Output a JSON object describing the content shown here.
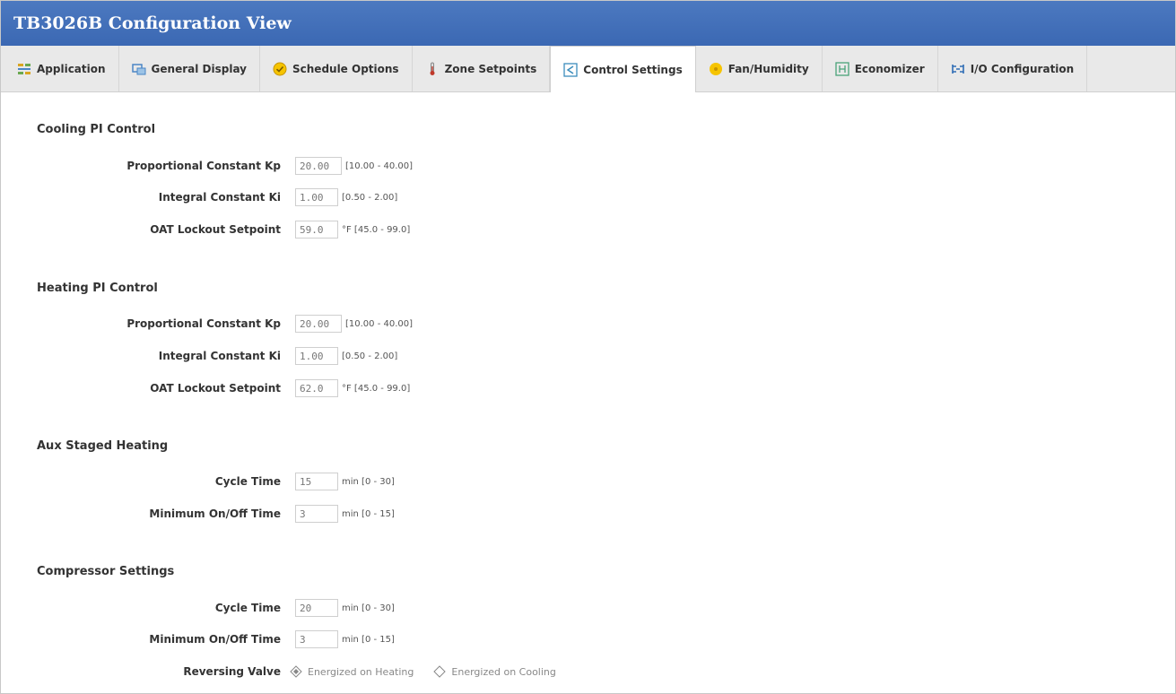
{
  "window": {
    "title": "TB3026B Configuration View"
  },
  "tabs": [
    {
      "label": "Application",
      "icon": "application-icon"
    },
    {
      "label": "General Display",
      "icon": "general-display-icon"
    },
    {
      "label": "Schedule Options",
      "icon": "schedule-icon"
    },
    {
      "label": "Zone Setpoints",
      "icon": "thermometer-icon"
    },
    {
      "label": "Control Settings",
      "icon": "control-settings-icon",
      "active": true
    },
    {
      "label": "Fan/Humidity",
      "icon": "fan-icon"
    },
    {
      "label": "Economizer",
      "icon": "economizer-icon"
    },
    {
      "label": "I/O Configuration",
      "icon": "io-config-icon"
    }
  ],
  "cooling": {
    "title": "Cooling PI Control",
    "kp": {
      "label": "Proportional Constant Kp",
      "value": "20.00",
      "range": "[10.00 - 40.00]"
    },
    "ki": {
      "label": "Integral Constant Ki",
      "value": "1.00",
      "range": "[0.50 - 2.00]"
    },
    "oat": {
      "label": "OAT Lockout Setpoint",
      "value": "59.0",
      "range": "°F [45.0 - 99.0]"
    }
  },
  "heating": {
    "title": "Heating PI Control",
    "kp": {
      "label": "Proportional Constant Kp",
      "value": "20.00",
      "range": "[10.00 - 40.00]"
    },
    "ki": {
      "label": "Integral Constant Ki",
      "value": "1.00",
      "range": "[0.50 - 2.00]"
    },
    "oat": {
      "label": "OAT Lockout Setpoint",
      "value": "62.0",
      "range": "°F [45.0 - 99.0]"
    }
  },
  "aux": {
    "title": "Aux Staged Heating",
    "cycle": {
      "label": "Cycle Time",
      "value": "15",
      "range": "min [0 - 30]"
    },
    "minonoff": {
      "label": "Minimum On/Off Time",
      "value": "3",
      "range": "min [0 - 15]"
    }
  },
  "compressor": {
    "title": "Compressor Settings",
    "cycle": {
      "label": "Cycle Time",
      "value": "20",
      "range": "min [0 - 30]"
    },
    "minonoff": {
      "label": "Minimum On/Off Time",
      "value": "3",
      "range": "min [0 - 15]"
    },
    "reversing": {
      "label": "Reversing Valve",
      "options": [
        "Energized on Heating",
        "Energized on Cooling"
      ],
      "selected": "Energized on Heating"
    }
  },
  "colors": {
    "title_bar": "#3b68b3",
    "tab_bar": "#e9e9e9",
    "radio_selected": "#888888"
  }
}
